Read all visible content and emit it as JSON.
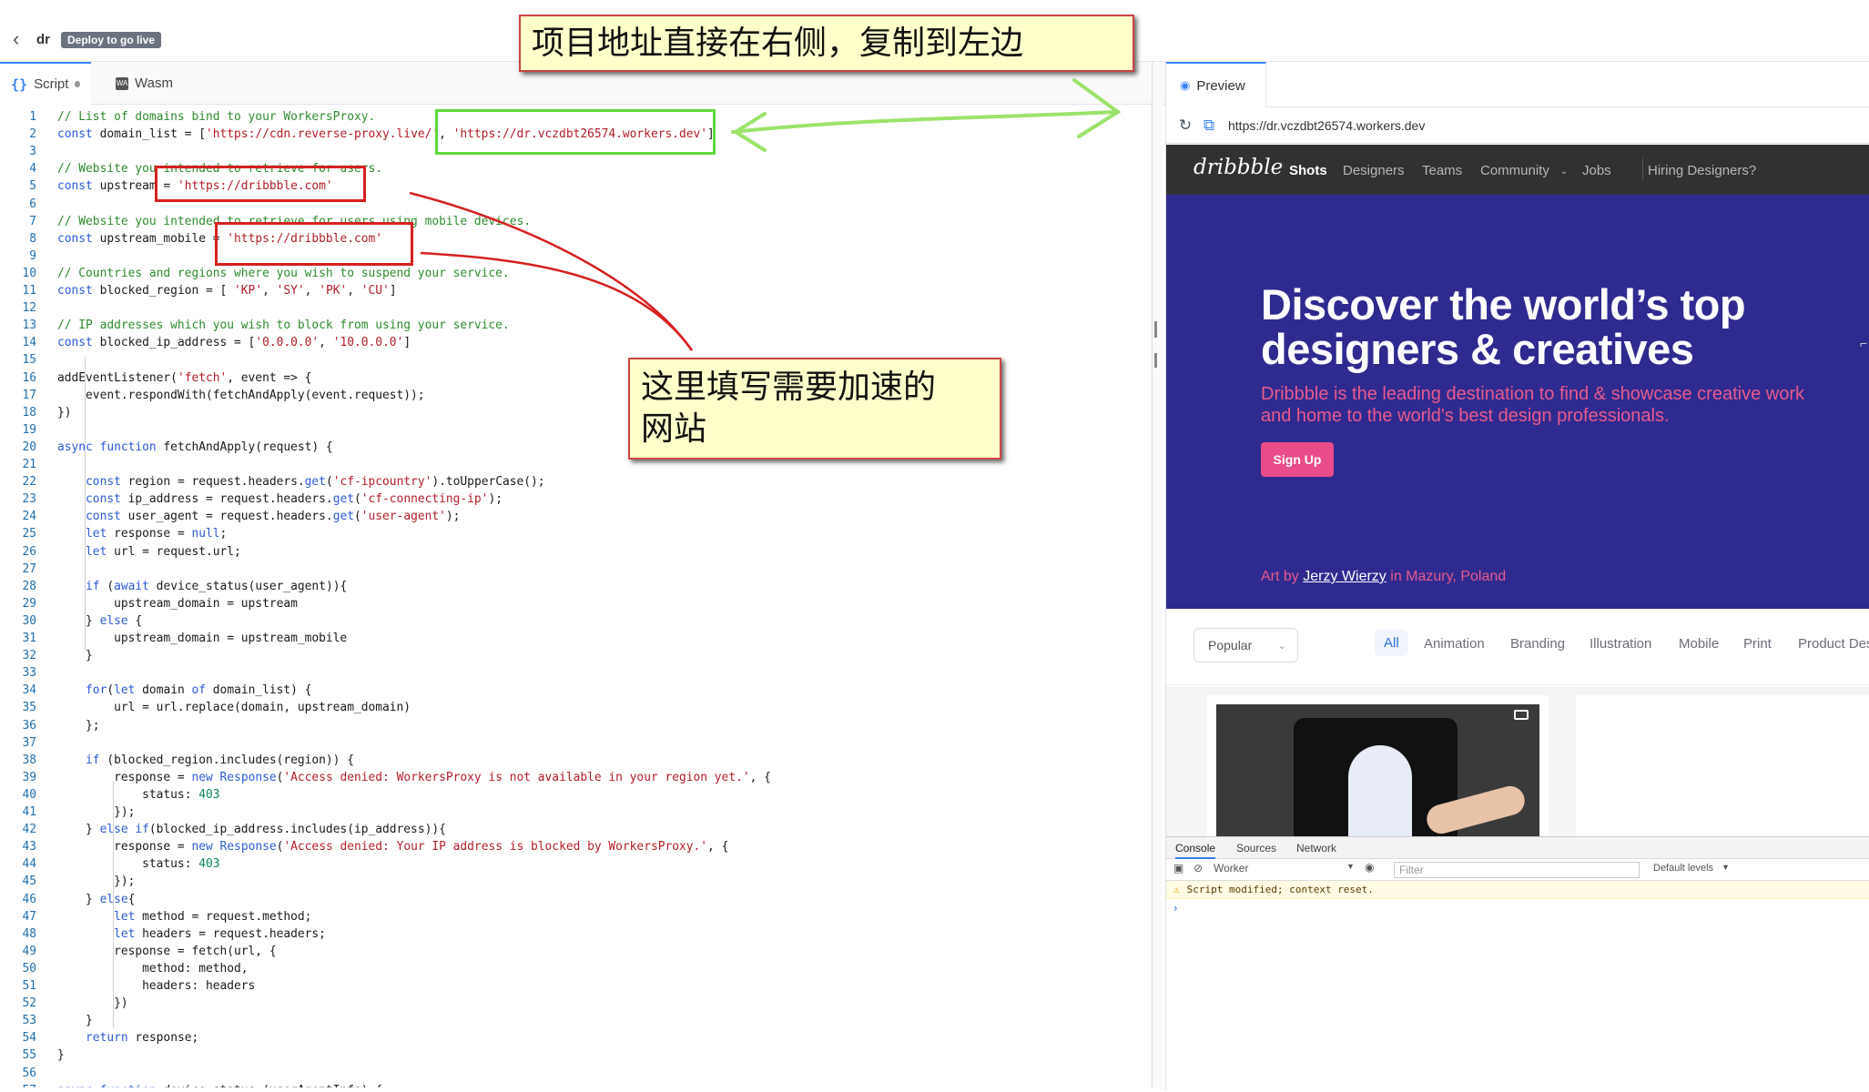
{
  "header": {
    "project_name": "dr",
    "deploy_label": "Deploy to go live"
  },
  "editor": {
    "tabs": [
      {
        "label": "Script",
        "modified": true
      },
      {
        "label": "Wasm"
      }
    ],
    "lines": [
      {
        "n": "1",
        "segs": [
          [
            "cm",
            "// List of domains bind to your WorkersProxy."
          ]
        ]
      },
      {
        "n": "2",
        "segs": [
          [
            "kw",
            "const"
          ],
          [
            "",
            " domain_list = ["
          ],
          [
            "st",
            "'https://cdn.reverse-proxy.live/'"
          ],
          [
            "",
            ", "
          ],
          [
            "st",
            "'https://dr.vczdbt26574.workers.dev'"
          ],
          [
            "",
            "]"
          ]
        ]
      },
      {
        "n": "3",
        "segs": []
      },
      {
        "n": "4",
        "segs": [
          [
            "cm",
            "// Website you intended to retrieve for users."
          ]
        ]
      },
      {
        "n": "5",
        "segs": [
          [
            "kw",
            "const"
          ],
          [
            "",
            " upstream = "
          ],
          [
            "st",
            "'https://dribbble.com'"
          ]
        ]
      },
      {
        "n": "6",
        "segs": []
      },
      {
        "n": "7",
        "segs": [
          [
            "cm",
            "// Website you intended to retrieve for users using mobile devices."
          ]
        ]
      },
      {
        "n": "8",
        "segs": [
          [
            "kw",
            "const"
          ],
          [
            "",
            " upstream_mobile = "
          ],
          [
            "st",
            "'https://dribbble.com'"
          ]
        ]
      },
      {
        "n": "9",
        "segs": []
      },
      {
        "n": "10",
        "segs": [
          [
            "cm",
            "// Countries and regions where you wish to suspend your service."
          ]
        ]
      },
      {
        "n": "11",
        "segs": [
          [
            "kw",
            "const"
          ],
          [
            "",
            " blocked_region = [ "
          ],
          [
            "st",
            "'KP'"
          ],
          [
            "",
            ", "
          ],
          [
            "st",
            "'SY'"
          ],
          [
            "",
            ", "
          ],
          [
            "st",
            "'PK'"
          ],
          [
            "",
            ", "
          ],
          [
            "st",
            "'CU'"
          ],
          [
            "",
            "]"
          ]
        ]
      },
      {
        "n": "12",
        "segs": []
      },
      {
        "n": "13",
        "segs": [
          [
            "cm",
            "// IP addresses which you wish to block from using your service."
          ]
        ]
      },
      {
        "n": "14",
        "segs": [
          [
            "kw",
            "const"
          ],
          [
            "",
            " blocked_ip_address = ["
          ],
          [
            "st",
            "'0.0.0.0'"
          ],
          [
            "",
            ", "
          ],
          [
            "st",
            "'10.0.0.0'"
          ],
          [
            "",
            "]"
          ]
        ]
      },
      {
        "n": "15",
        "segs": []
      },
      {
        "n": "16",
        "segs": [
          [
            "",
            "addEventListener("
          ],
          [
            "st",
            "'fetch'"
          ],
          [
            "",
            ", event => {"
          ]
        ]
      },
      {
        "n": "17",
        "segs": [
          [
            "",
            "    event.respondWith(fetchAndApply(event.request));"
          ]
        ]
      },
      {
        "n": "18",
        "segs": [
          [
            "",
            "})"
          ]
        ]
      },
      {
        "n": "19",
        "segs": []
      },
      {
        "n": "20",
        "segs": [
          [
            "kw",
            "async function"
          ],
          [
            "",
            " fetchAndApply(request) {"
          ]
        ]
      },
      {
        "n": "21",
        "segs": []
      },
      {
        "n": "22",
        "segs": [
          [
            "",
            "    "
          ],
          [
            "kw",
            "const"
          ],
          [
            "",
            " region = request.headers."
          ],
          [
            "kw",
            "get"
          ],
          [
            "",
            "("
          ],
          [
            "st",
            "'cf-ipcountry'"
          ],
          [
            "",
            ").toUpperCase();"
          ]
        ]
      },
      {
        "n": "23",
        "segs": [
          [
            "",
            "    "
          ],
          [
            "kw",
            "const"
          ],
          [
            "",
            " ip_address = request.headers."
          ],
          [
            "kw",
            "get"
          ],
          [
            "",
            "("
          ],
          [
            "st",
            "'cf-connecting-ip'"
          ],
          [
            "",
            ");"
          ]
        ]
      },
      {
        "n": "24",
        "segs": [
          [
            "",
            "    "
          ],
          [
            "kw",
            "const"
          ],
          [
            "",
            " user_agent = request.headers."
          ],
          [
            "kw",
            "get"
          ],
          [
            "",
            "("
          ],
          [
            "st",
            "'user-agent'"
          ],
          [
            "",
            ");"
          ]
        ]
      },
      {
        "n": "25",
        "segs": [
          [
            "",
            "    "
          ],
          [
            "kw",
            "let"
          ],
          [
            "",
            " response = "
          ],
          [
            "kw",
            "null"
          ],
          [
            "",
            ";"
          ]
        ]
      },
      {
        "n": "26",
        "segs": [
          [
            "",
            "    "
          ],
          [
            "kw",
            "let"
          ],
          [
            "",
            " url = request.url;"
          ]
        ]
      },
      {
        "n": "27",
        "segs": []
      },
      {
        "n": "28",
        "segs": [
          [
            "",
            "    "
          ],
          [
            "kw",
            "if"
          ],
          [
            "",
            " ("
          ],
          [
            "kw",
            "await"
          ],
          [
            "",
            " device_status(user_agent)){"
          ]
        ]
      },
      {
        "n": "29",
        "segs": [
          [
            "",
            "        upstream_domain = upstream"
          ]
        ]
      },
      {
        "n": "30",
        "segs": [
          [
            "",
            "    } "
          ],
          [
            "kw",
            "else"
          ],
          [
            "",
            " {"
          ]
        ]
      },
      {
        "n": "31",
        "segs": [
          [
            "",
            "        upstream_domain = upstream_mobile"
          ]
        ]
      },
      {
        "n": "32",
        "segs": [
          [
            "",
            "    }"
          ]
        ]
      },
      {
        "n": "33",
        "segs": []
      },
      {
        "n": "34",
        "segs": [
          [
            "",
            "    "
          ],
          [
            "kw",
            "for"
          ],
          [
            "",
            "("
          ],
          [
            "kw",
            "let"
          ],
          [
            "",
            " domain "
          ],
          [
            "kw",
            "of"
          ],
          [
            "",
            " domain_list) {"
          ]
        ]
      },
      {
        "n": "35",
        "segs": [
          [
            "",
            "        url = url.replace(domain, upstream_domain)"
          ]
        ]
      },
      {
        "n": "36",
        "segs": [
          [
            "",
            "    };"
          ]
        ]
      },
      {
        "n": "37",
        "segs": []
      },
      {
        "n": "38",
        "segs": [
          [
            "",
            "    "
          ],
          [
            "kw",
            "if"
          ],
          [
            "",
            " (blocked_region.includes(region)) {"
          ]
        ]
      },
      {
        "n": "39",
        "segs": [
          [
            "",
            "        response = "
          ],
          [
            "kw",
            "new"
          ],
          [
            "",
            " "
          ],
          [
            "kw",
            "Response"
          ],
          [
            "",
            "("
          ],
          [
            "st",
            "'Access denied: WorkersProxy is not available in your region yet.'"
          ],
          [
            "",
            ", {"
          ]
        ]
      },
      {
        "n": "40",
        "segs": [
          [
            "",
            "            status: "
          ],
          [
            "nm",
            "403"
          ]
        ]
      },
      {
        "n": "41",
        "segs": [
          [
            "",
            "        });"
          ]
        ]
      },
      {
        "n": "42",
        "segs": [
          [
            "",
            "    } "
          ],
          [
            "kw",
            "else if"
          ],
          [
            "",
            "(blocked_ip_address.includes(ip_address)){"
          ]
        ]
      },
      {
        "n": "43",
        "segs": [
          [
            "",
            "        response = "
          ],
          [
            "kw",
            "new"
          ],
          [
            "",
            " "
          ],
          [
            "kw",
            "Response"
          ],
          [
            "",
            "("
          ],
          [
            "st",
            "'Access denied: Your IP address is blocked by WorkersProxy.'"
          ],
          [
            "",
            ", {"
          ]
        ]
      },
      {
        "n": "44",
        "segs": [
          [
            "",
            "            status: "
          ],
          [
            "nm",
            "403"
          ]
        ]
      },
      {
        "n": "45",
        "segs": [
          [
            "",
            "        });"
          ]
        ]
      },
      {
        "n": "46",
        "segs": [
          [
            "",
            "    } "
          ],
          [
            "kw",
            "else"
          ],
          [
            "",
            "{"
          ]
        ]
      },
      {
        "n": "47",
        "segs": [
          [
            "",
            "        "
          ],
          [
            "kw",
            "let"
          ],
          [
            "",
            " method = request.method;"
          ]
        ]
      },
      {
        "n": "48",
        "segs": [
          [
            "",
            "        "
          ],
          [
            "kw",
            "let"
          ],
          [
            "",
            " headers = request.headers;"
          ]
        ]
      },
      {
        "n": "49",
        "segs": [
          [
            "",
            "        response = fetch(url, {"
          ]
        ]
      },
      {
        "n": "50",
        "segs": [
          [
            "",
            "            method: method,"
          ]
        ]
      },
      {
        "n": "51",
        "segs": [
          [
            "",
            "            headers: headers"
          ]
        ]
      },
      {
        "n": "52",
        "segs": [
          [
            "",
            "        })"
          ]
        ]
      },
      {
        "n": "53",
        "segs": [
          [
            "",
            "    }"
          ]
        ]
      },
      {
        "n": "54",
        "segs": [
          [
            "",
            "    "
          ],
          [
            "kw",
            "return"
          ],
          [
            "",
            " response;"
          ]
        ]
      },
      {
        "n": "55",
        "segs": [
          [
            "",
            "}"
          ]
        ]
      },
      {
        "n": "56",
        "segs": []
      },
      {
        "n": "57",
        "segs": [
          [
            "kw",
            "async function"
          ],
          [
            "",
            " device_status (userAgentInfo) {"
          ]
        ]
      }
    ]
  },
  "preview": {
    "tab_label": "Preview",
    "url": "https://dr.vczdbt26574.workers.dev",
    "site": {
      "logo": "dribbble",
      "nav": [
        "Shots",
        "Designers",
        "Teams",
        "Community",
        "Jobs",
        "Hiring Designers?"
      ],
      "hero_title_1": "Discover the world’s top",
      "hero_title_2": "designers & creatives",
      "hero_sub": "Dribbble is the leading destination to find & showcase creative work and home to the world's best design professionals.",
      "signup": "Sign Up",
      "art_prefix": "Art by",
      "art_author": "Jerzy Wierzy",
      "art_suffix": "in Mazury, Poland",
      "filter_select": "Popular",
      "categories": [
        "All",
        "Animation",
        "Branding",
        "Illustration",
        "Mobile",
        "Print",
        "Product Des"
      ],
      "hero_bg": "#2f2a8f",
      "accent": "#ea4c89"
    }
  },
  "console": {
    "tabs": [
      "Console",
      "Sources",
      "Network"
    ],
    "context": "Worker",
    "filter_placeholder": "Filter",
    "levels": "Default levels",
    "warning": "Script modified; context reset.",
    "prompt": "›"
  },
  "annotations": {
    "callout_1": "项目地址直接在右侧，复制到左边",
    "callout_2_line1": "这里填写需要加速的",
    "callout_2_line2": "网站"
  }
}
